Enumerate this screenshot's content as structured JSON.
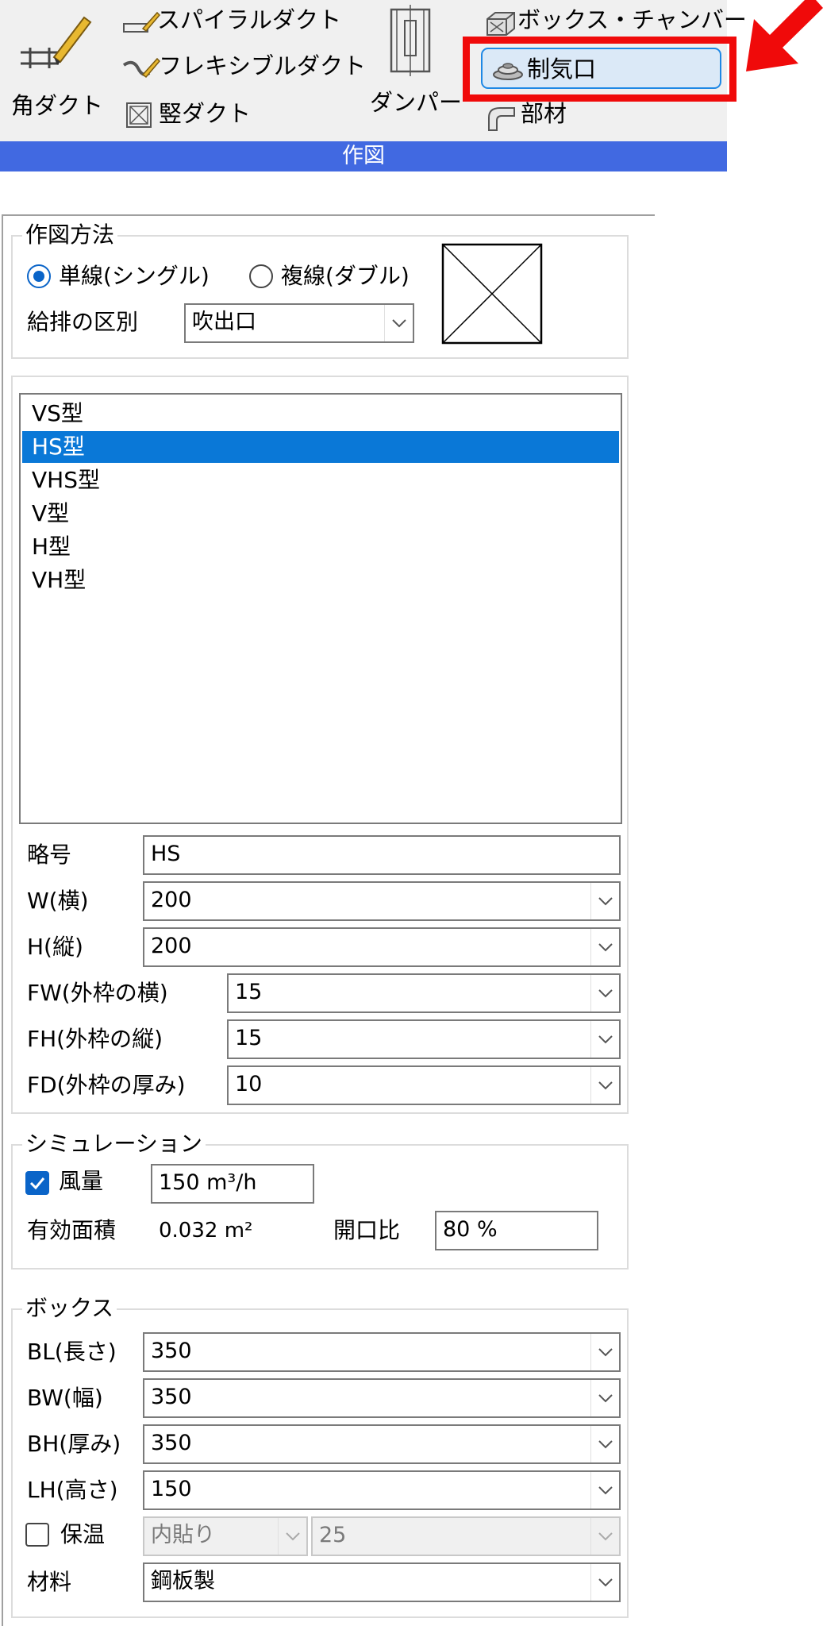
{
  "ribbon": {
    "rect_duct": "角ダクト",
    "spiral_duct": "スパイラルダクト",
    "flexible_duct": "フレキシブルダクト",
    "vertical_duct": "竪ダクト",
    "damper": "ダンパー",
    "box_chamber": "ボックス・チャンバー",
    "air_outlet": "制気口",
    "parts": "部材",
    "group_label": "作図",
    "accent": "#4169e1",
    "highlight": "#f00a0a"
  },
  "method": {
    "title": "作図方法",
    "single_label": "単線(シングル)",
    "double_label": "複線(ダブル)",
    "selected": "single",
    "supply_label": "給排の区別",
    "supply_value": "吹出口"
  },
  "types": {
    "items": [
      "VS型",
      "HS型",
      "VHS型",
      "V型",
      "H型",
      "VH型"
    ],
    "selected_index": 1
  },
  "params": {
    "symbol_label": "略号",
    "symbol_value": "HS",
    "w_label": "W(横)",
    "w_value": "200",
    "h_label": "H(縦)",
    "h_value": "200",
    "fw_label": "FW(外枠の横)",
    "fw_value": "15",
    "fh_label": "FH(外枠の縦)",
    "fh_value": "15",
    "fd_label": "FD(外枠の厚み)",
    "fd_value": "10"
  },
  "simulation": {
    "title": "シミュレーション",
    "airflow_label": "風量",
    "airflow_checked": true,
    "airflow_value": "150 m³/h",
    "area_label": "有効面積",
    "area_value": "0.032 m²",
    "ratio_label": "開口比",
    "ratio_value": "80 %"
  },
  "box": {
    "title": "ボックス",
    "bl_label": "BL(長さ)",
    "bl_value": "350",
    "bw_label": "BW(幅)",
    "bw_value": "350",
    "bh_label": "BH(厚み)",
    "bh_value": "350",
    "lh_label": "LH(高さ)",
    "lh_value": "150",
    "insulation_label": "保温",
    "insulation_checked": false,
    "insulation_type": "内貼り",
    "insulation_thickness": "25",
    "material_label": "材料",
    "material_value": "鋼板製"
  }
}
